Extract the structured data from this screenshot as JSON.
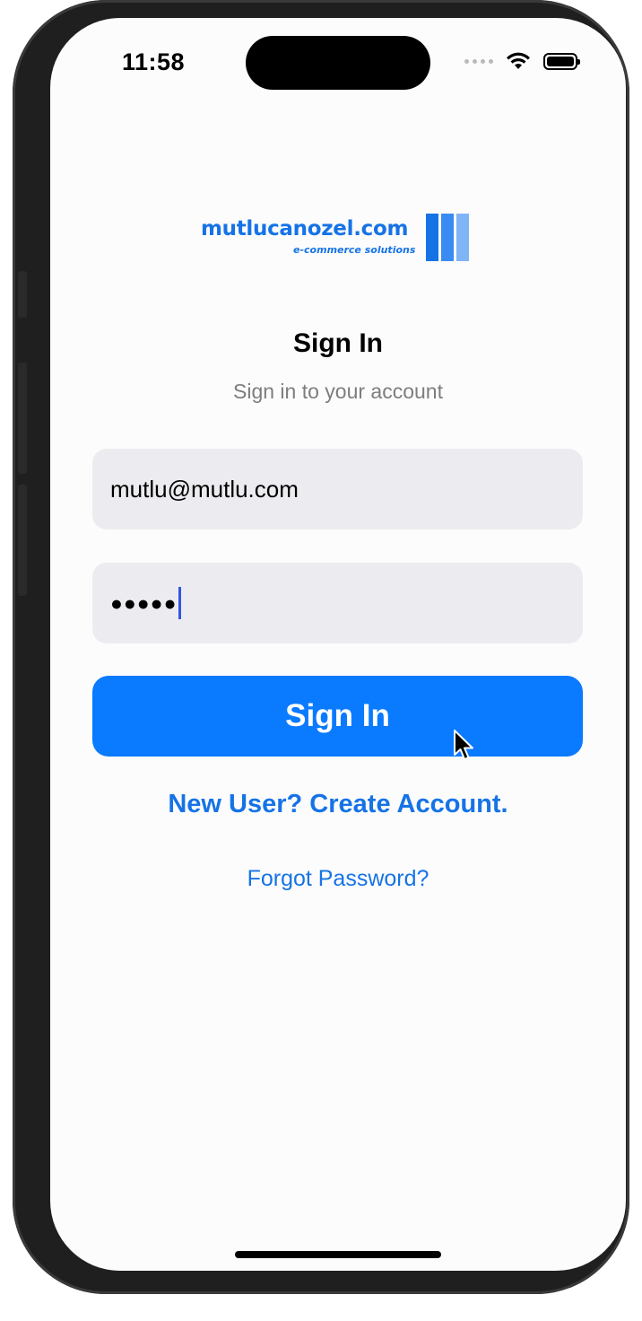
{
  "status_bar": {
    "time": "11:58"
  },
  "logo": {
    "name": "mutlucanozel.com",
    "tagline": "e-commerce solutions",
    "bar_colors": [
      "#1673e6",
      "#3a8cf2",
      "#7fb4f7"
    ]
  },
  "header": {
    "title": "Sign In",
    "subtitle": "Sign in to your account"
  },
  "form": {
    "email_value": "mutlu@mutlu.com",
    "password_masked": "●●●●●"
  },
  "buttons": {
    "sign_in_label": "Sign In"
  },
  "links": {
    "create_account": "New User? Create Account.",
    "forgot_password": "Forgot Password?"
  },
  "colors": {
    "accent": "#0a7aff",
    "link": "#1673e6",
    "field_bg": "#ececf0"
  }
}
